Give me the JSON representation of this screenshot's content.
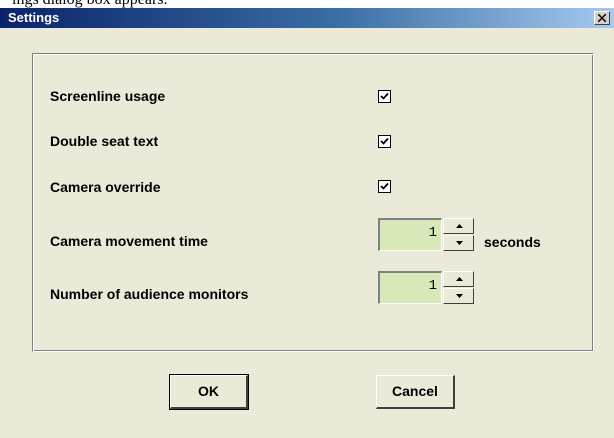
{
  "background_text": "ings dialog box appears.",
  "window": {
    "title": "Settings",
    "close_glyph": "close-icon"
  },
  "settings": {
    "screenline_usage": {
      "label": "Screenline usage",
      "checked": true
    },
    "double_seat_text": {
      "label": "Double seat text",
      "checked": true
    },
    "camera_override": {
      "label": "Camera override",
      "checked": true
    },
    "camera_movement_time": {
      "label": "Camera movement time",
      "value": "1",
      "unit": "seconds"
    },
    "audience_monitors": {
      "label": "Number of audience monitors",
      "value": "1"
    }
  },
  "buttons": {
    "ok": "OK",
    "cancel": "Cancel"
  },
  "colors": {
    "dialog_bg": "#ebe9d8",
    "title_gradient_start": "#0a246a",
    "title_gradient_end": "#a6caf0",
    "numeric_field_bg": "#d9e8b8"
  }
}
